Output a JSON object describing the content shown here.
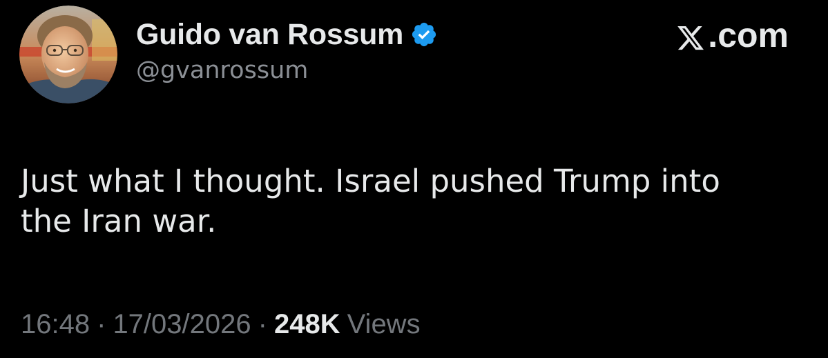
{
  "author": {
    "display_name": "Guido van Rossum",
    "handle": "@gvanrossum",
    "verified": true
  },
  "brand": {
    "label": ".com",
    "icon": "x-logo-icon"
  },
  "tweet": {
    "lines": [
      "Just what I thought. Israel pushed Trump into",
      "the Iran war."
    ]
  },
  "meta": {
    "time": "16:48",
    "separator": "·",
    "date": "17/03/2026",
    "views_count": "248K",
    "views_label": "Views"
  },
  "colors": {
    "background": "#000000",
    "primary_text": "#e7e9ea",
    "secondary_text": "#8b8f95",
    "verified_badge": "#1d9bf0"
  },
  "icons": {
    "avatar": "profile-photo",
    "verified": "verified-badge-icon"
  }
}
